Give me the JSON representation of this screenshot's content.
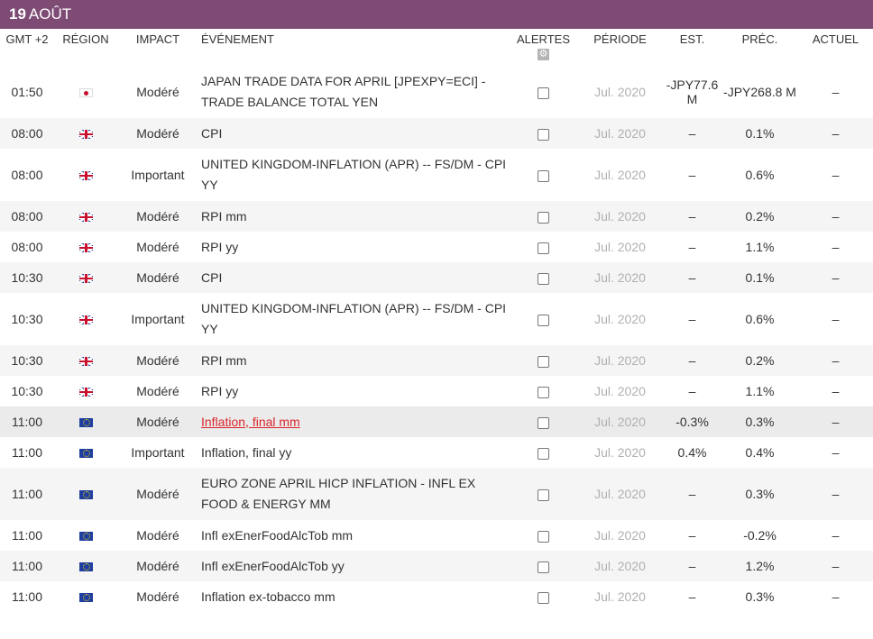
{
  "date_header": {
    "day": "19",
    "month": "AOÛT"
  },
  "columns": {
    "time": "GMT +2",
    "region": "RÉGION",
    "impact": "IMPACT",
    "event": "ÉVÉNEMENT",
    "alerts": "ALERTES",
    "period": "PÉRIODE",
    "est": "EST.",
    "prev": "PRÉC.",
    "actual": "ACTUEL"
  },
  "icons": {
    "settings": "gear-icon",
    "flag_jp": "japan-flag-icon",
    "flag_gb": "uk-flag-icon",
    "flag_eu": "eu-flag-icon"
  },
  "colors": {
    "header_bg": "#7e4b74",
    "link": "#d9262a",
    "period_text": "#b0b0b0"
  },
  "events": [
    {
      "time": "01:50",
      "region": "jp",
      "impact": "Modéré",
      "event": "JAPAN TRADE DATA FOR APRIL [JPEXPY=ECI] - TRADE BALANCE TOTAL YEN",
      "period": "Jul. 2020",
      "est": "-JPY77.6 M",
      "prev": "-JPY268.8 M",
      "actual": "–"
    },
    {
      "time": "08:00",
      "region": "gb",
      "impact": "Modéré",
      "event": "CPI",
      "period": "Jul. 2020",
      "est": "–",
      "prev": "0.1%",
      "actual": "–"
    },
    {
      "time": "08:00",
      "region": "gb",
      "impact": "Important",
      "event": "UNITED KINGDOM-INFLATION (APR) -- FS/DM - CPI YY",
      "period": "Jul. 2020",
      "est": "–",
      "prev": "0.6%",
      "actual": "–"
    },
    {
      "time": "08:00",
      "region": "gb",
      "impact": "Modéré",
      "event": "RPI mm",
      "period": "Jul. 2020",
      "est": "–",
      "prev": "0.2%",
      "actual": "–"
    },
    {
      "time": "08:00",
      "region": "gb",
      "impact": "Modéré",
      "event": "RPI yy",
      "period": "Jul. 2020",
      "est": "–",
      "prev": "1.1%",
      "actual": "–"
    },
    {
      "time": "10:30",
      "region": "gb",
      "impact": "Modéré",
      "event": "CPI",
      "period": "Jul. 2020",
      "est": "–",
      "prev": "0.1%",
      "actual": "–"
    },
    {
      "time": "10:30",
      "region": "gb",
      "impact": "Important",
      "event": "UNITED KINGDOM-INFLATION (APR) -- FS/DM - CPI YY",
      "period": "Jul. 2020",
      "est": "–",
      "prev": "0.6%",
      "actual": "–"
    },
    {
      "time": "10:30",
      "region": "gb",
      "impact": "Modéré",
      "event": "RPI mm",
      "period": "Jul. 2020",
      "est": "–",
      "prev": "0.2%",
      "actual": "–"
    },
    {
      "time": "10:30",
      "region": "gb",
      "impact": "Modéré",
      "event": "RPI yy",
      "period": "Jul. 2020",
      "est": "–",
      "prev": "1.1%",
      "actual": "–"
    },
    {
      "time": "11:00",
      "region": "eu",
      "impact": "Modéré",
      "event": "Inflation, final mm",
      "period": "Jul. 2020",
      "est": "-0.3%",
      "prev": "0.3%",
      "actual": "–",
      "link": true
    },
    {
      "time": "11:00",
      "region": "eu",
      "impact": "Important",
      "event": "Inflation, final yy",
      "period": "Jul. 2020",
      "est": "0.4%",
      "prev": "0.4%",
      "actual": "–"
    },
    {
      "time": "11:00",
      "region": "eu",
      "impact": "Modéré",
      "event": "EURO ZONE APRIL HICP INFLATION - INFL EX FOOD & ENERGY MM",
      "period": "Jul. 2020",
      "est": "–",
      "prev": "0.3%",
      "actual": "–"
    },
    {
      "time": "11:00",
      "region": "eu",
      "impact": "Modéré",
      "event": "Infl exEnerFoodAlcTob mm",
      "period": "Jul. 2020",
      "est": "–",
      "prev": "-0.2%",
      "actual": "–"
    },
    {
      "time": "11:00",
      "region": "eu",
      "impact": "Modéré",
      "event": "Infl exEnerFoodAlcTob yy",
      "period": "Jul. 2020",
      "est": "–",
      "prev": "1.2%",
      "actual": "–"
    },
    {
      "time": "11:00",
      "region": "eu",
      "impact": "Modéré",
      "event": "Inflation ex-tobacco mm",
      "period": "Jul. 2020",
      "est": "–",
      "prev": "0.3%",
      "actual": "–"
    }
  ]
}
